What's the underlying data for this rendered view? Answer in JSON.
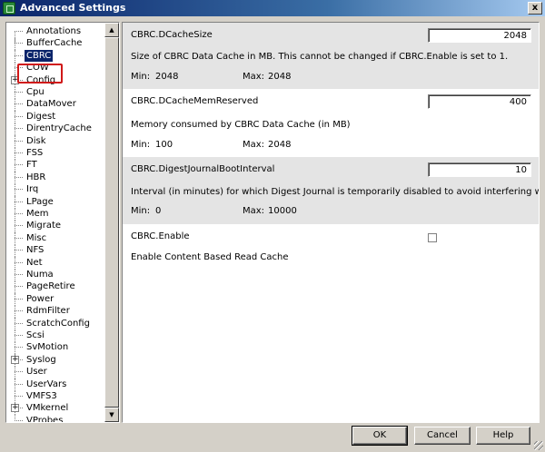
{
  "window": {
    "title": "Advanced Settings",
    "close_label": "x"
  },
  "tree": {
    "items": [
      {
        "label": "Annotations",
        "expandable": false,
        "selected": false
      },
      {
        "label": "BufferCache",
        "expandable": false,
        "selected": false
      },
      {
        "label": "CBRC",
        "expandable": false,
        "selected": true
      },
      {
        "label": "COW",
        "expandable": false,
        "selected": false
      },
      {
        "label": "Config",
        "expandable": true,
        "selected": false
      },
      {
        "label": "Cpu",
        "expandable": false,
        "selected": false
      },
      {
        "label": "DataMover",
        "expandable": false,
        "selected": false
      },
      {
        "label": "Digest",
        "expandable": false,
        "selected": false
      },
      {
        "label": "DirentryCache",
        "expandable": false,
        "selected": false
      },
      {
        "label": "Disk",
        "expandable": false,
        "selected": false
      },
      {
        "label": "FSS",
        "expandable": false,
        "selected": false
      },
      {
        "label": "FT",
        "expandable": false,
        "selected": false
      },
      {
        "label": "HBR",
        "expandable": false,
        "selected": false
      },
      {
        "label": "Irq",
        "expandable": false,
        "selected": false
      },
      {
        "label": "LPage",
        "expandable": false,
        "selected": false
      },
      {
        "label": "Mem",
        "expandable": false,
        "selected": false
      },
      {
        "label": "Migrate",
        "expandable": false,
        "selected": false
      },
      {
        "label": "Misc",
        "expandable": false,
        "selected": false
      },
      {
        "label": "NFS",
        "expandable": false,
        "selected": false
      },
      {
        "label": "Net",
        "expandable": false,
        "selected": false
      },
      {
        "label": "Numa",
        "expandable": false,
        "selected": false
      },
      {
        "label": "PageRetire",
        "expandable": false,
        "selected": false
      },
      {
        "label": "Power",
        "expandable": false,
        "selected": false
      },
      {
        "label": "RdmFilter",
        "expandable": false,
        "selected": false
      },
      {
        "label": "ScratchConfig",
        "expandable": false,
        "selected": false
      },
      {
        "label": "Scsi",
        "expandable": false,
        "selected": false
      },
      {
        "label": "SvMotion",
        "expandable": false,
        "selected": false
      },
      {
        "label": "Syslog",
        "expandable": true,
        "selected": false
      },
      {
        "label": "User",
        "expandable": false,
        "selected": false
      },
      {
        "label": "UserVars",
        "expandable": false,
        "selected": false
      },
      {
        "label": "VMFS3",
        "expandable": false,
        "selected": false
      },
      {
        "label": "VMkernel",
        "expandable": true,
        "selected": false
      },
      {
        "label": "VProbes",
        "expandable": false,
        "selected": false
      }
    ]
  },
  "settings": [
    {
      "name": "CBRC.DCacheSize",
      "value": "2048",
      "description": "Size of CBRC Data Cache in MB. This cannot be changed if CBRC.Enable is set to 1.",
      "min_label": "Min:",
      "min": "2048",
      "max_label": "Max:",
      "max": "2048"
    },
    {
      "name": "CBRC.DCacheMemReserved",
      "value": "400",
      "description": "Memory consumed by CBRC Data Cache (in MB)",
      "min_label": "Min:",
      "min": "100",
      "max_label": "Max:",
      "max": "2048"
    },
    {
      "name": "CBRC.DigestJournalBootInterval",
      "value": "10",
      "description": "Interval (in minutes) for which Digest Journal is temporarily disabled to avoid interfering with the boot ...",
      "min_label": "Min:",
      "min": "0",
      "max_label": "Max:",
      "max": "10000"
    },
    {
      "name": "CBRC.Enable",
      "checked": false,
      "description": "Enable Content Based Read Cache"
    }
  ],
  "buttons": {
    "ok": "OK",
    "cancel": "Cancel",
    "help": "Help"
  }
}
